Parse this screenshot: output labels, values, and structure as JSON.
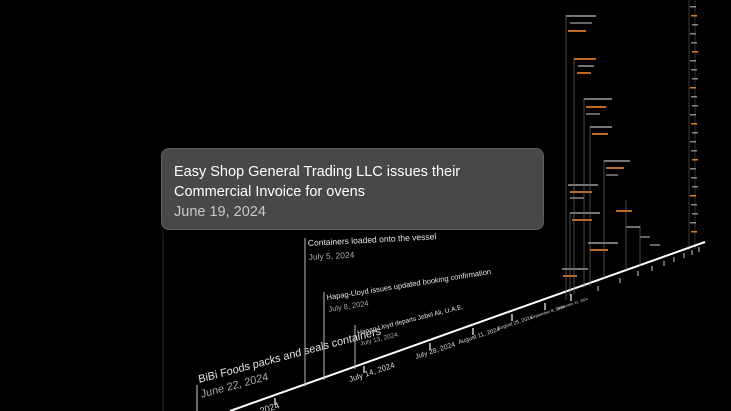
{
  "tooltip": {
    "title": "Easy Shop General Trading LLC issues their Commercial Invoice for ovens",
    "date": "June 19, 2024"
  },
  "events": [
    {
      "title": "BiBi Foods packs and seals containers",
      "date": "June 22, 2024"
    },
    {
      "title": "Containers loaded onto the vessel",
      "date": "July 5, 2024"
    },
    {
      "title": "Hapag-Lloyd issues updated booking confirmation",
      "date": "July 8, 2024"
    },
    {
      "title": "Hapag-Lloyd departs Jebel Ali, U.A.E.",
      "date": "July 13, 2024"
    }
  ],
  "axis_ticks": [
    "2024",
    "July 14, 2024",
    "July 28, 2024",
    "August 11, 2024",
    "August 25, 2024",
    "September 8, 2024",
    "September 22, 2024"
  ],
  "colors": {
    "background": "#000000",
    "axis": "#ffffff",
    "accent_orange": "#e07b2a",
    "tooltip_bg": "#4e4e4e"
  }
}
